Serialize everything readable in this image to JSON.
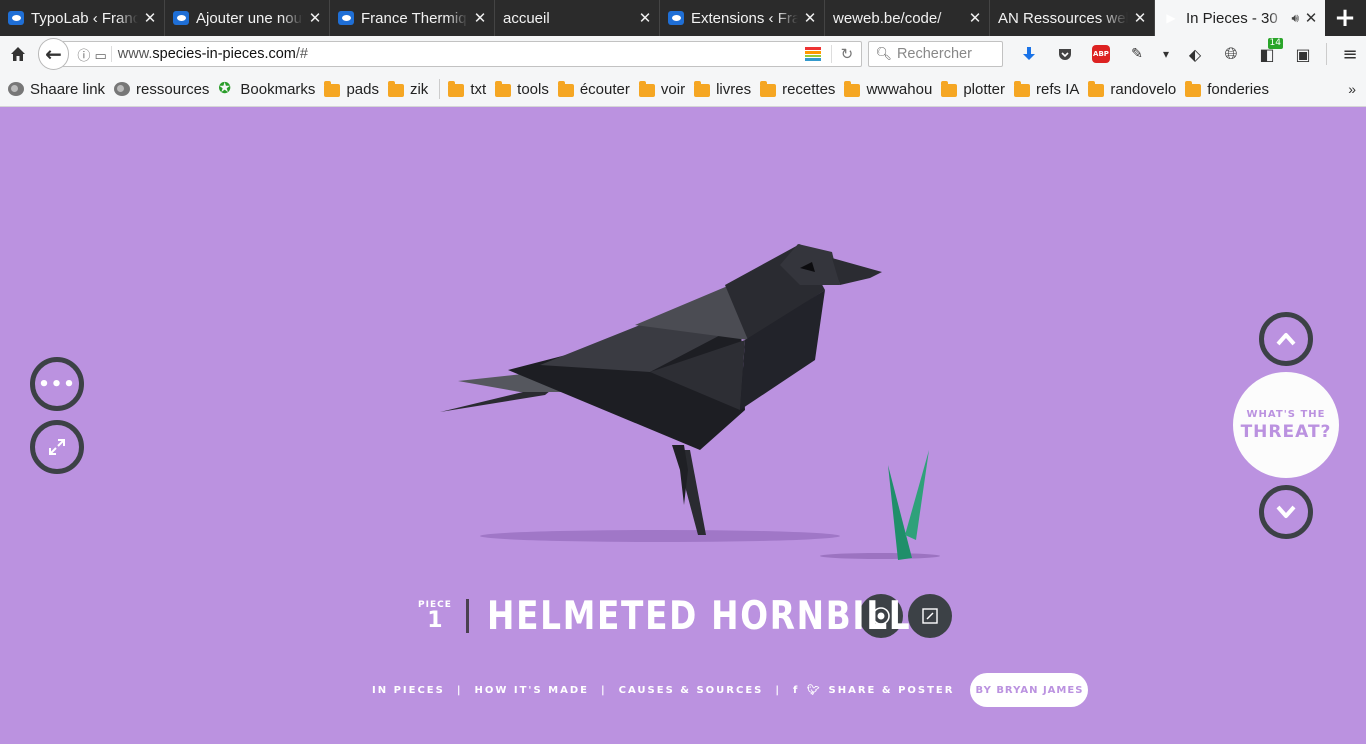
{
  "browser": {
    "tabs": [
      {
        "title": "TypoLab ‹ France",
        "icon": "wordpress-icon",
        "active": false
      },
      {
        "title": "Ajouter une nouvelle",
        "icon": "wordpress-icon",
        "active": false
      },
      {
        "title": "France Thermique",
        "icon": "wordpress-icon",
        "active": false
      },
      {
        "title": "accueil",
        "icon": "none",
        "active": false
      },
      {
        "title": "Extensions ‹ France",
        "icon": "wordpress-icon",
        "active": false
      },
      {
        "title": "weweb.be/code/",
        "icon": "none",
        "active": false
      },
      {
        "title": "AN Ressources web",
        "icon": "none",
        "active": false
      },
      {
        "title": "In Pieces - 30",
        "icon": "play-icon",
        "active": true
      }
    ],
    "url": {
      "prefix": "www.",
      "domain": "species-in-pieces.com",
      "path": "/#"
    },
    "search_placeholder": "Rechercher",
    "addon_badge": "14",
    "abp_label": "ABP",
    "bookmarks": [
      {
        "label": "Shaare link",
        "icon": "globe-icon"
      },
      {
        "label": "ressources",
        "icon": "globe-icon"
      },
      {
        "label": "Bookmarks",
        "icon": "star-icon"
      },
      {
        "label": "pads",
        "icon": "folder-icon"
      },
      {
        "label": "zik",
        "icon": "folder-icon"
      },
      {
        "label": "txt",
        "icon": "folder-icon"
      },
      {
        "label": "tools",
        "icon": "folder-icon"
      },
      {
        "label": "écouter",
        "icon": "folder-icon"
      },
      {
        "label": "voir",
        "icon": "folder-icon"
      },
      {
        "label": "livres",
        "icon": "folder-icon"
      },
      {
        "label": "recettes",
        "icon": "folder-icon"
      },
      {
        "label": "wwwahou",
        "icon": "folder-icon"
      },
      {
        "label": "plotter",
        "icon": "folder-icon"
      },
      {
        "label": "refs IA",
        "icon": "folder-icon"
      },
      {
        "label": "randovelo",
        "icon": "folder-icon"
      },
      {
        "label": "fonderies",
        "icon": "folder-icon"
      }
    ]
  },
  "site": {
    "background_color": "#bb92e0",
    "dark_color": "#3c4146",
    "threat": {
      "line1": "WHAT'S THE",
      "line2": "THREAT?"
    },
    "piece": {
      "label": "PIECE",
      "number": "1"
    },
    "species_name": "HELMETED HORNBILL",
    "footer": {
      "in_pieces": "IN PIECES",
      "how_made": "HOW IT'S MADE",
      "causes": "CAUSES & SOURCES",
      "social_icons": "f ✦",
      "share": "SHARE & POSTER",
      "byline": "BY BRYAN JAMES"
    }
  }
}
